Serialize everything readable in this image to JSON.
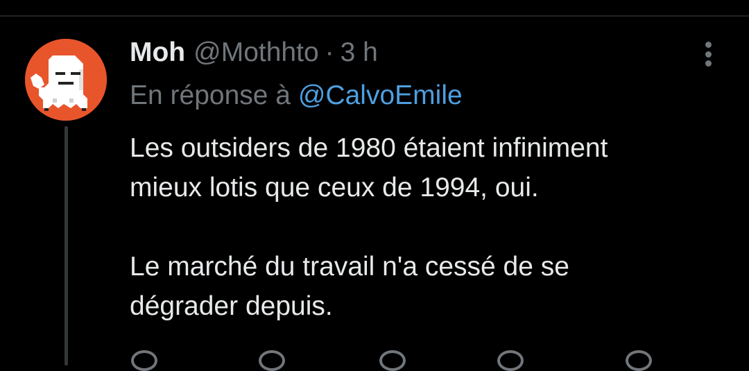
{
  "tweet": {
    "author": {
      "display_name": "Moh",
      "handle": "@Mothhto"
    },
    "separator": "·",
    "timestamp": "3 h",
    "reply_prefix": "En réponse à",
    "reply_mention": "@CalvoEmile",
    "paragraphs": [
      [
        "Les outsiders de 1980 étaient infiniment",
        "mieux lotis que ceux de 1994, oui."
      ],
      [
        "Le marché du travail n'a cessé de se",
        "dégrader depuis."
      ]
    ]
  },
  "colors": {
    "background": "#000000",
    "text_primary": "#e7e9ea",
    "text_secondary": "#71767b",
    "mention": "#4f9fe0",
    "avatar_bg": "#e8552b"
  },
  "icons": {
    "more": "more-vertical-icon",
    "avatar": "pixel-ghost-avatar",
    "actions": [
      "reply-icon",
      "repost-icon",
      "like-icon",
      "views-icon",
      "bookmark-icon"
    ]
  }
}
